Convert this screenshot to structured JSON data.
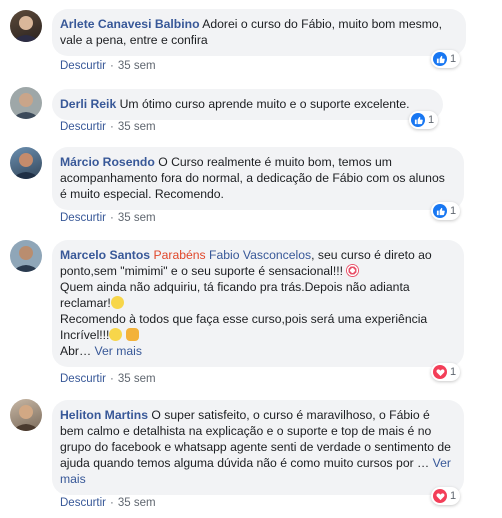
{
  "actions": {
    "reply_label": "Descurtir",
    "separator": "·"
  },
  "comments": [
    {
      "author": "Arlete Canavesi Balbino",
      "text": "Adorei o curso do Fábio, muito bom mesmo, vale a pena, entre e confira",
      "time": "35 sem",
      "reaction": {
        "type": "like",
        "count": "1",
        "color": "#1877f2"
      }
    },
    {
      "author": "Derli Reik",
      "text": "Um ótimo curso aprende muito e o suporte excelente.",
      "time": "35 sem",
      "reaction": {
        "type": "like",
        "count": "1",
        "color": "#1877f2"
      }
    },
    {
      "author": "Márcio Rosendo",
      "text": "O Curso realmente é muito bom, temos um acompanhamento fora do normal, a dedicação de Fábio com os alunos é muito especial. Recomendo.",
      "time": "35 sem",
      "reaction": {
        "type": "like",
        "count": "1",
        "color": "#1877f2"
      }
    },
    {
      "author": "Marcelo Santos",
      "mention_1": "Parabéns",
      "mention_2": "Fabio Vasconcelos",
      "text_1": ", seu curso é direto ao ponto,sem \"mimimi\" e o seu suporte é sensacional!!!",
      "text_2": "Quem ainda não adquiriu, tá ficando pra trás.Depois não adianta reclamar!",
      "text_3": "Recomendo à todos que faça esse curso,pois será uma experiência Incrível!!!",
      "text_4": "Abr…",
      "more": "Ver mais",
      "time": "35 sem",
      "reaction": {
        "type": "love",
        "count": "1",
        "color": "#f33e58"
      }
    },
    {
      "author": "Heliton Martins",
      "text": "O super satisfeito, o curso é maravilhoso, o Fábio é bem calmo e detalhista na explicação e o suporte e top de mais é no grupo do facebook e whatsapp agente senti de verdade o sentimento de ajuda quando temos alguma dúvida não é como muito cursos por …",
      "more": "Ver mais",
      "time": "35 sem",
      "reaction": {
        "type": "love",
        "count": "1",
        "color": "#f33e58"
      }
    }
  ]
}
